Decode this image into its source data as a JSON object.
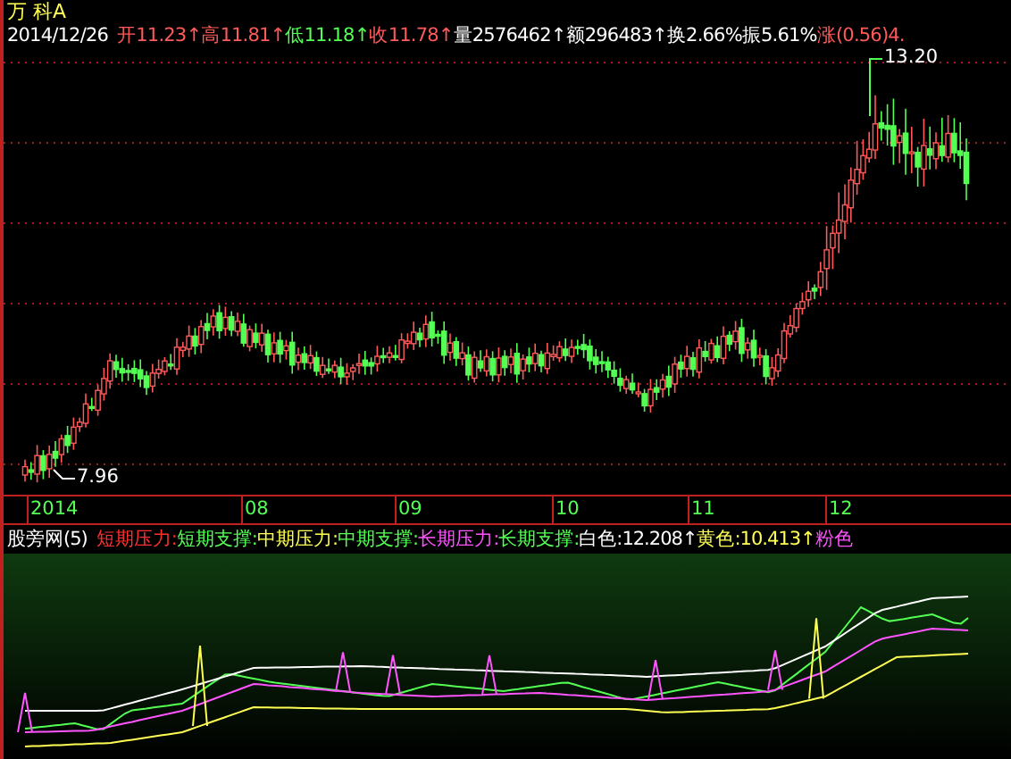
{
  "stock": {
    "name": "万 科A",
    "date": "2014/12/26"
  },
  "quote": [
    {
      "label": "开",
      "value": "11.23",
      "arrow": "↑",
      "color": "#ff5a5a"
    },
    {
      "label": "高",
      "value": "11.81",
      "arrow": "↑",
      "color": "#ff5a5a"
    },
    {
      "label": "低",
      "value": "11.18",
      "arrow": "↑",
      "color": "#54ff54"
    },
    {
      "label": "收",
      "value": "11.78",
      "arrow": "↑",
      "color": "#ff5a5a"
    },
    {
      "label": "量",
      "value": "2576462",
      "arrow": "↑",
      "color": "#ffffff"
    },
    {
      "label": "额",
      "value": "296483",
      "arrow": "↑",
      "color": "#ffffff"
    },
    {
      "label": "换",
      "value": "2.66%",
      "color": "#ffffff"
    },
    {
      "label": "振",
      "value": "5.61%",
      "color": "#ffffff"
    },
    {
      "label": "涨",
      "value": "(0.56)4.",
      "color": "#ff5a5a"
    }
  ],
  "price_chart": {
    "high_label": "13.20",
    "low_label": "7.96"
  },
  "x_axis": [
    "2014",
    "08",
    "09",
    "10",
    "11",
    "12"
  ],
  "indicator": {
    "title": "股旁网(5)",
    "legend": [
      {
        "text": "短期压力:",
        "color": "#ff3030"
      },
      {
        "text": "短期支撑:",
        "color": "#54ff54"
      },
      {
        "text": "中期压力:",
        "color": "#ffff54"
      },
      {
        "text": "中期支撑:",
        "color": "#54ff54"
      },
      {
        "text": "长期压力:",
        "color": "#ff54ff"
      },
      {
        "text": "长期支撑:",
        "color": "#54ff54"
      },
      {
        "text": "白色:12.208↑",
        "color": "#ffffff"
      },
      {
        "text": "黄色:10.413↑",
        "color": "#ffff54"
      },
      {
        "text": "粉色",
        "color": "#ff54ff"
      }
    ]
  }
}
